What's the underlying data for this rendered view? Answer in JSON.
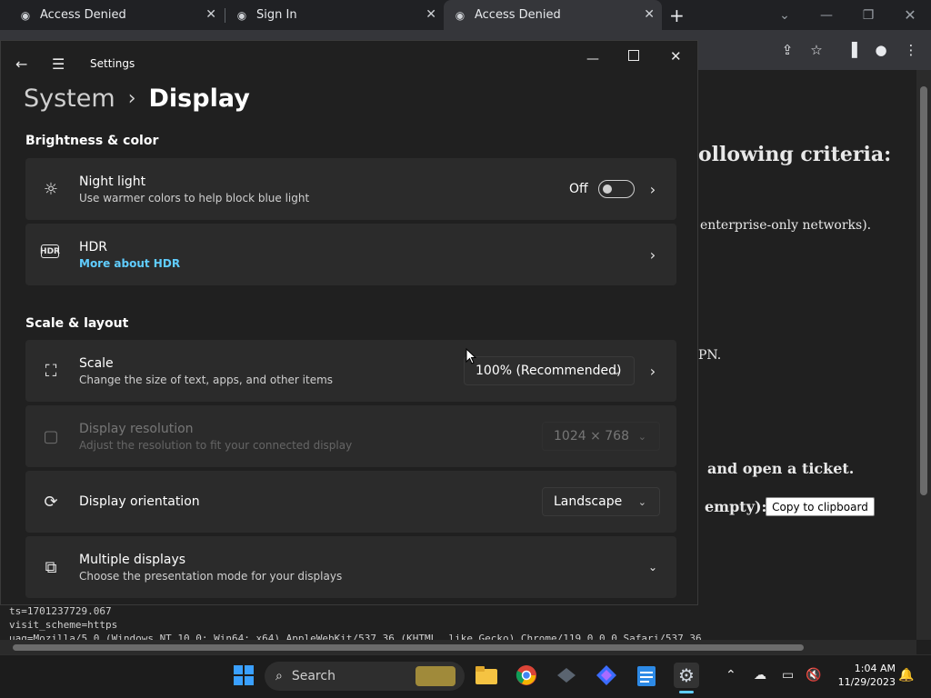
{
  "browser": {
    "tabs": [
      {
        "label": "Access Denied",
        "icon": "steam-icon"
      },
      {
        "label": "Sign In",
        "icon": "steam-icon"
      },
      {
        "label": "Access Denied",
        "icon": "steam-icon"
      }
    ],
    "new_tab": "+",
    "page_fragments": {
      "criteria": "ollowing criteria:",
      "networks": "enterprise-only networks).",
      "vpn": "PN.",
      "ticket": "and open a ticket.",
      "empty": "empty):",
      "copy_button": "Copy to clipboard"
    },
    "debug_lines": [
      "ts=1701237729.067",
      "visit_scheme=https",
      "uag=Mozilla/5.0 (Windows NT 10.0; Win64; x64) AppleWebKit/537.36 (KHTML, like Gecko) Chrome/119.0.0.0 Safari/537.36"
    ]
  },
  "settings": {
    "window_title": "Settings",
    "breadcrumb": {
      "parent": "System",
      "separator": "›",
      "current": "Display"
    },
    "sections": {
      "brightness": "Brightness & color",
      "scale_layout": "Scale & layout"
    },
    "night_light": {
      "title": "Night light",
      "subtitle": "Use warmer colors to help block blue light",
      "state": "Off"
    },
    "hdr": {
      "title": "HDR",
      "link": "More about HDR"
    },
    "scale": {
      "title": "Scale",
      "subtitle": "Change the size of text, apps, and other items",
      "value": "100% (Recommended)"
    },
    "resolution": {
      "title": "Display resolution",
      "subtitle": "Adjust the resolution to fit your connected display",
      "value": "1024 × 768"
    },
    "orientation": {
      "title": "Display orientation",
      "value": "Landscape"
    },
    "multiple": {
      "title": "Multiple displays",
      "subtitle": "Choose the presentation mode for your displays"
    },
    "accent_link": "#60cdff"
  },
  "taskbar": {
    "search_placeholder": "Search",
    "time": "1:04 AM",
    "date": "11/29/2023"
  }
}
